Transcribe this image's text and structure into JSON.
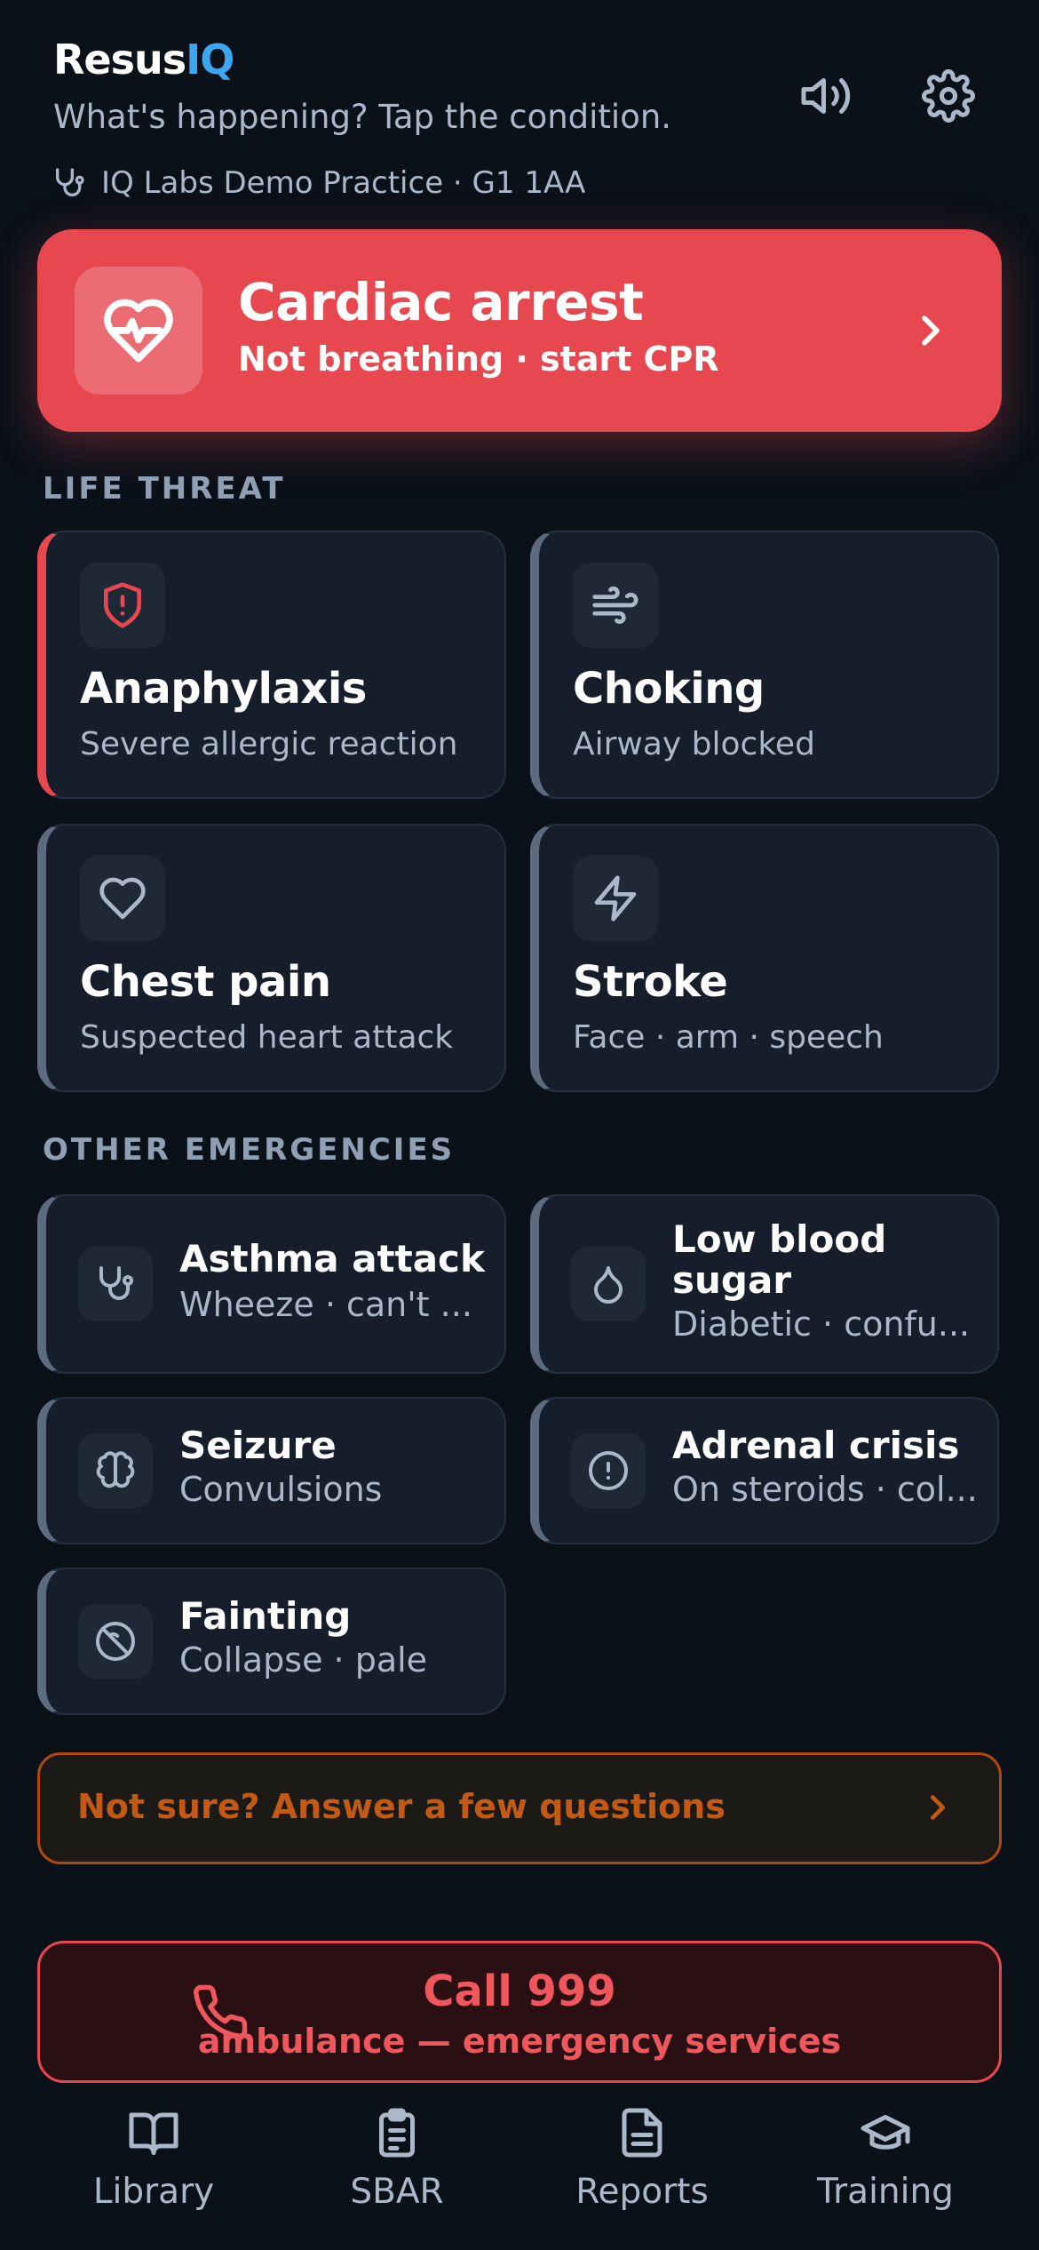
{
  "header": {
    "brand_main": "Resus",
    "brand_accent": "IQ",
    "subtitle": "What's happening? Tap the condition.",
    "practice": "IQ Labs Demo Practice · G1 1AA",
    "icons": [
      "speaker-icon",
      "gear-icon",
      "stethoscope-icon"
    ]
  },
  "cardiac": {
    "title": "Cardiac arrest",
    "subtitle": "Not breathing · start CPR",
    "icon": "heart-pulse-icon",
    "color": "#e7484f"
  },
  "sections": {
    "life_threat": "LIFE THREAT",
    "other": "OTHER EMERGENCIES"
  },
  "life_threat": [
    {
      "title": "Anaphylaxis",
      "subtitle": "Severe allergic reaction",
      "icon": "shield-alert-icon"
    },
    {
      "title": "Choking",
      "subtitle": "Airway blocked",
      "icon": "wind-icon"
    },
    {
      "title": "Chest pain",
      "subtitle": "Suspected heart attack",
      "icon": "heart-icon"
    },
    {
      "title": "Stroke",
      "subtitle": "Face · arm · speech",
      "icon": "zap-icon"
    }
  ],
  "other": [
    {
      "title": "Asthma attack",
      "subtitle": "Wheeze · can't ...",
      "icon": "stethoscope-icon"
    },
    {
      "title": "Low blood sugar",
      "subtitle": "Diabetic · confu...",
      "icon": "droplet-icon"
    },
    {
      "title": "Seizure",
      "subtitle": "Convulsions",
      "icon": "brain-icon"
    },
    {
      "title": "Adrenal crisis",
      "subtitle": "On steroids · col...",
      "icon": "alert-circle-icon"
    },
    {
      "title": "Fainting",
      "subtitle": "Collapse · pale",
      "icon": "circle-off-icon"
    }
  ],
  "notsure": {
    "label": "Not sure? Answer a few questions",
    "color": "#c25a16"
  },
  "call": {
    "title": "Call 999",
    "subtitle": "ambulance — emergency services",
    "icon": "phone-icon"
  },
  "nav": [
    {
      "label": "Library",
      "icon": "book-icon"
    },
    {
      "label": "SBAR",
      "icon": "clipboard-icon"
    },
    {
      "label": "Reports",
      "icon": "file-text-icon"
    },
    {
      "label": "Training",
      "icon": "graduation-cap-icon"
    }
  ]
}
